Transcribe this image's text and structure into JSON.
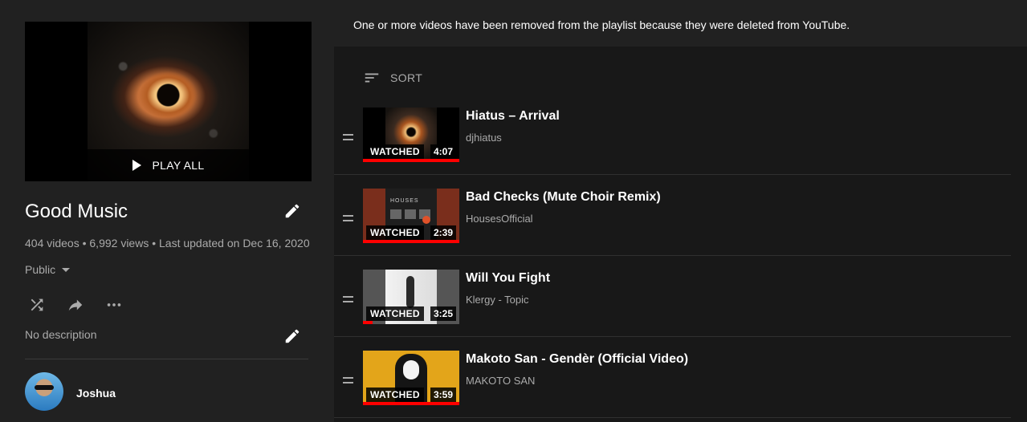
{
  "playlist": {
    "play_all_label": "PLAY ALL",
    "title": "Good Music",
    "meta": "404 videos • 6,992 views • Last updated on Dec 16, 2020",
    "privacy": "Public",
    "description": "No description",
    "owner": "Joshua"
  },
  "notice": "One or more videos have been removed from the playlist because they were deleted from YouTube.",
  "sort_label": "SORT",
  "videos": [
    {
      "title": "Hiatus – Arrival",
      "channel": "djhiatus",
      "status": "WATCHED",
      "duration": "4:07",
      "progress": 1.0,
      "thumb_color": "#1d1a17"
    },
    {
      "title": "Bad Checks (Mute Choir Remix)",
      "channel": "HousesOfficial",
      "status": "WATCHED",
      "duration": "2:39",
      "progress": 1.0,
      "thumb_color": "#7a2e1c"
    },
    {
      "title": "Will You Fight",
      "channel": "Klergy - Topic",
      "status": "WATCHED",
      "duration": "3:25",
      "progress": 0.1,
      "thumb_color": "#e8e8e8"
    },
    {
      "title": "Makoto San - Gendèr (Official Video)",
      "channel": "MAKOTO SAN",
      "status": "WATCHED",
      "duration": "3:59",
      "progress": 1.0,
      "thumb_color": "#e3a51a"
    }
  ],
  "thumb_text_2": "HOUSES",
  "colors": {
    "accent": "#ff0000",
    "background": "#181818",
    "panel": "#212121"
  }
}
